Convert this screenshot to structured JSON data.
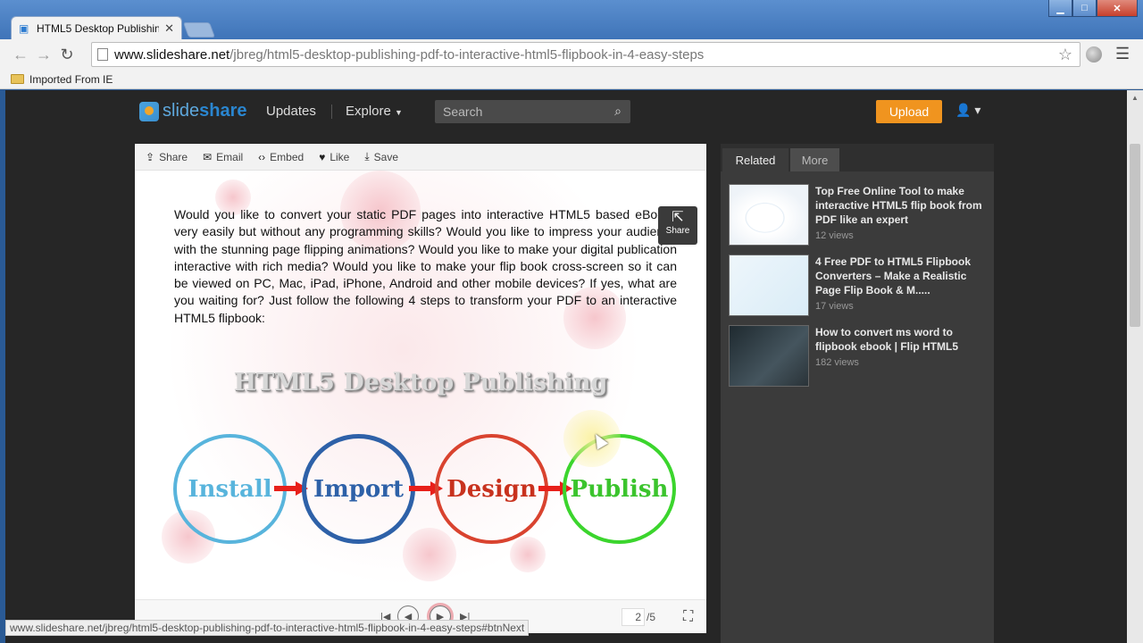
{
  "browser": {
    "tab_title": "HTML5 Desktop Publishin",
    "url_host": "www.slideshare.net",
    "url_path": "/jbreg/html5-desktop-publishing-pdf-to-interactive-html5-flipbook-in-4-easy-steps",
    "bookmark": "Imported From IE",
    "status_url": "www.slideshare.net/jbreg/html5-desktop-publishing-pdf-to-interactive-html5-flipbook-in-4-easy-steps#btnNext"
  },
  "header": {
    "logo_a": "slide",
    "logo_b": "share",
    "updates": "Updates",
    "explore": "Explore",
    "search_placeholder": "Search",
    "upload": "Upload"
  },
  "actions": {
    "share": "Share",
    "email": "Email",
    "embed": "Embed",
    "like": "Like",
    "save": "Save"
  },
  "slide": {
    "paragraph": "Would you like to convert your static PDF pages into interactive HTML5 based eBooks very easily but without any programming skills? Would you like to impress your audience with the stunning page flipping animations? Would you like to make your digital publication interactive with rich media? Would you like to make your flip book cross-screen so it can be viewed on PC, Mac, iPad, iPhone, Android and other mobile devices? If yes, what are you waiting for? Just follow the following 4 steps to transform your PDF to an interactive HTML5 flipbook:",
    "title": "HTML5 Desktop Publishing",
    "steps": [
      "Install",
      "Import",
      "Design",
      "Publish"
    ],
    "share_overlay": "Share"
  },
  "controls": {
    "page_current": "2",
    "page_total": "/5"
  },
  "sidebar": {
    "tabs": [
      "Related",
      "More"
    ],
    "items": [
      {
        "title": "Top Free Online Tool to make interactive HTML5 flip book from PDF like an expert",
        "views": "12 views"
      },
      {
        "title": "4 Free PDF to HTML5 Flipbook Converters – Make a Realistic Page Flip Book & M.....",
        "views": "17 views"
      },
      {
        "title": "How to convert ms word to flipbook ebook | Flip HTML5",
        "views": "182 views"
      }
    ]
  },
  "colors": {
    "accent_upload": "#f0941f",
    "install": "#58b4dc",
    "import": "#2e61a8",
    "design": "#c8321e",
    "publish": "#3bc42d"
  }
}
